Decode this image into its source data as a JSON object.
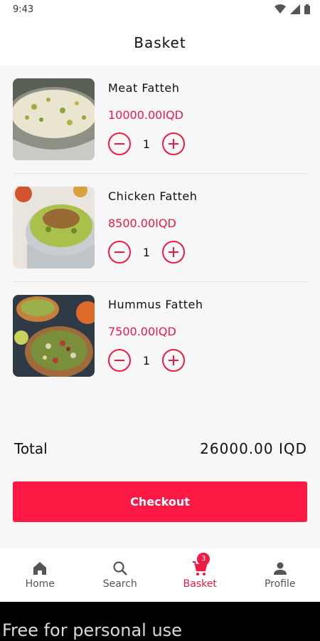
{
  "status_bar": {
    "time": "9:43"
  },
  "header": {
    "title": "Basket"
  },
  "items": [
    {
      "name": "Meat Fatteh",
      "price": "10000.00IQD",
      "quantity": "1"
    },
    {
      "name": "Chicken Fatteh",
      "price": "8500.00IQD",
      "quantity": "1"
    },
    {
      "name": "Hummus Fatteh",
      "price": "7500.00IQD",
      "quantity": "1"
    }
  ],
  "summary": {
    "total_label": "Total",
    "total_value": "26000.00 IQD"
  },
  "checkout": {
    "label": "Checkout"
  },
  "nav": {
    "home": "Home",
    "search": "Search",
    "basket": "Basket",
    "basket_badge": "3",
    "profile": "Profile"
  },
  "watermark": {
    "text": "Free for personal use"
  },
  "colors": {
    "accent": "#ef1b44",
    "button": "#ff1a46"
  }
}
